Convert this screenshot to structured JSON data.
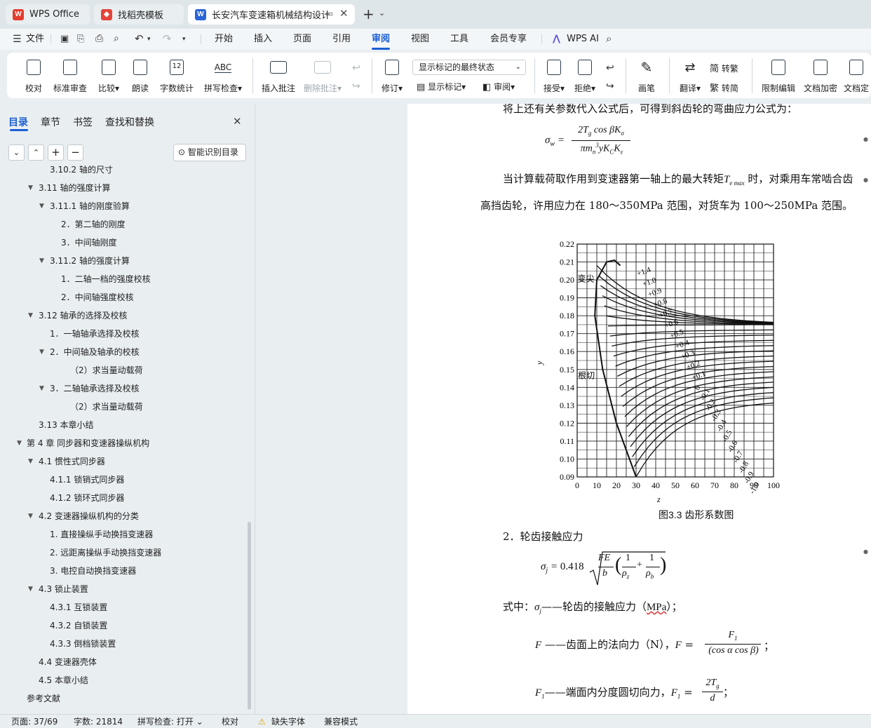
{
  "tabs": {
    "wps_office": "WPS Office",
    "template": "找稻壳模板",
    "document": "长安汽车变速箱机械结构设计"
  },
  "menu": {
    "file": "文件",
    "items": [
      "开始",
      "插入",
      "页面",
      "引用",
      "审阅",
      "视图",
      "工具",
      "会员专享"
    ],
    "active": "审阅",
    "ai": "WPS AI"
  },
  "ribbon": {
    "proofread": "校对",
    "standard_review": "标准审查",
    "compare": "比较",
    "read_aloud": "朗读",
    "word_count": "字数统计",
    "spell_check": "拼写检查",
    "insert_comment": "插入批注",
    "delete_comment": "删除批注",
    "track_changes": "修订",
    "markup_state": "显示标记的最终状态",
    "show_markup": "显示标记",
    "review": "审阅",
    "accept": "接受",
    "reject": "拒绝",
    "pen": "画笔",
    "translate": "翻译",
    "to_traditional": "转繁",
    "to_simplified": "转简",
    "restrict_editing": "限制编辑",
    "doc_encrypt": "文档加密",
    "doc_final": "文档定",
    "word_count_icon": "12",
    "spell_icon": "ABC"
  },
  "nav": {
    "tabs": [
      "目录",
      "章节",
      "书签",
      "查找和替换"
    ],
    "smart_toc": "智能识别目录",
    "items": [
      {
        "text": "3.10.2 轴的尺寸",
        "level": 3,
        "tri": ""
      },
      {
        "text": "3.11 轴的强度计算",
        "level": 2,
        "tri": "▼"
      },
      {
        "text": "3.11.1 轴的刚度验算",
        "level": 3,
        "tri": "▼"
      },
      {
        "text": "2．第二轴的刚度",
        "level": 4,
        "tri": ""
      },
      {
        "text": "3．中间轴刚度",
        "level": 4,
        "tri": ""
      },
      {
        "text": "3.11.2 轴的强度计算",
        "level": 3,
        "tri": "▼"
      },
      {
        "text": "1．二轴一档的强度校核",
        "level": 4,
        "tri": ""
      },
      {
        "text": "2．中间轴强度校核",
        "level": 4,
        "tri": ""
      },
      {
        "text": "3.12 轴承的选择及校核",
        "level": 2,
        "tri": "▼"
      },
      {
        "text": "1．一轴轴承选择及校核",
        "level": 3,
        "tri": ""
      },
      {
        "text": "2．中间轴及轴承的校核",
        "level": 3,
        "tri": "▼"
      },
      {
        "text": "（2）求当量动载荷",
        "level": 5,
        "tri": ""
      },
      {
        "text": "3．二轴轴承选择及校核",
        "level": 3,
        "tri": "▼"
      },
      {
        "text": "（2）求当量动载荷",
        "level": 5,
        "tri": ""
      },
      {
        "text": "3.13 本章小结",
        "level": 2,
        "tri": ""
      },
      {
        "text": "第 4 章  同步器和变速器操纵机构",
        "level": 1,
        "tri": "▼"
      },
      {
        "text": "4.1 惯性式同步器",
        "level": 2,
        "tri": "▼"
      },
      {
        "text": "4.1.1 锁销式同步器",
        "level": 3,
        "tri": ""
      },
      {
        "text": "4.1.2 锁环式同步器",
        "level": 3,
        "tri": ""
      },
      {
        "text": "4.2  变速器操纵机构的分类",
        "level": 2,
        "tri": "▼"
      },
      {
        "text": "1. 直接操纵手动换挡变速器",
        "level": 3,
        "tri": ""
      },
      {
        "text": "2. 远距离操纵手动换挡变速器",
        "level": 3,
        "tri": ""
      },
      {
        "text": "3. 电控自动换挡变速器",
        "level": 3,
        "tri": ""
      },
      {
        "text": "4.3 锁止装置",
        "level": 2,
        "tri": "▼"
      },
      {
        "text": "4.3.1 互锁装置",
        "level": 3,
        "tri": ""
      },
      {
        "text": "4.3.2 自锁装置",
        "level": 3,
        "tri": ""
      },
      {
        "text": "4.3.3 倒档锁装置",
        "level": 3,
        "tri": ""
      },
      {
        "text": "4.4 变速器壳体",
        "level": 2,
        "tri": ""
      },
      {
        "text": "4.5 本章小结",
        "level": 2,
        "tri": ""
      },
      {
        "text": "参考文献",
        "level": 1,
        "tri": ""
      }
    ]
  },
  "doc": {
    "line0": "将上还有关参数代入公式后，可得到斜齿轮的弯曲应力公式为：",
    "para1a": "当计算载荷取作用到变速器第一轴上的最大转矩",
    "para1b": "时，对乘用车常啮合齿",
    "para2": "高挡齿轮，许用应力在 180～350MPa 范围，对货车为 100～250MPa 范围。",
    "fig_caption": "图3.3  齿形系数图",
    "section2": "2．轮齿接触应力",
    "where_a": "式中：",
    "where_b": "——轮齿的接触应力（",
    "where_c": "）；",
    "mpa": "MPa",
    "f_line_a": "——齿面上的法向力（N），",
    "f1_line_a": "——端面内分度圆切向力，",
    "formula_coef": "0.418"
  },
  "chart_data": {
    "type": "line",
    "xlabel": "z",
    "ylabel": "y",
    "x_ticks": [
      "0",
      "10",
      "20",
      "30",
      "40",
      "50",
      "60",
      "70",
      "80",
      "90",
      "100"
    ],
    "y_ticks": [
      "0.09",
      "0.10",
      "0.11",
      "0.12",
      "0.13",
      "0.14",
      "0.15",
      "0.16",
      "0.17",
      "0.18",
      "0.19",
      "0.20",
      "0.21",
      "0.22"
    ],
    "xlim": [
      0,
      100
    ],
    "ylim": [
      0.09,
      0.22
    ],
    "grid": true,
    "annotations": [
      "变尖",
      "根切"
    ],
    "curve_labels": [
      "+1.4",
      "+1.0",
      "+0.9",
      "+0.8",
      "+0.7",
      "+0.6",
      "+0.5",
      "+0.4",
      "+0.3",
      "+0.2",
      "+0.1",
      "0",
      "-0.1",
      "-0.2",
      "-0.3",
      "-0.4",
      "-0.5",
      "-0.6",
      "-0.7",
      "-0.8",
      "-0.9",
      "-1.0"
    ],
    "series": [
      {
        "name": "+1.4",
        "x": [
          10,
          20,
          40,
          60,
          80,
          100
        ],
        "y": [
          0.205,
          0.2,
          0.189,
          0.182,
          0.178,
          0.175
        ]
      },
      {
        "name": "+0.7",
        "x": [
          10,
          20,
          40,
          60,
          80,
          100
        ],
        "y": [
          0.19,
          0.188,
          0.184,
          0.18,
          0.177,
          0.175
        ]
      },
      {
        "name": "+0.5",
        "x": [
          15,
          20,
          40,
          60,
          80,
          100
        ],
        "y": [
          0.172,
          0.175,
          0.177,
          0.177,
          0.176,
          0.175
        ]
      },
      {
        "name": "0",
        "x": [
          23,
          30,
          40,
          60,
          80,
          100
        ],
        "y": [
          0.135,
          0.144,
          0.152,
          0.161,
          0.166,
          0.169
        ]
      },
      {
        "name": "-0.5",
        "x": [
          28,
          40,
          60,
          80,
          100
        ],
        "y": [
          0.1,
          0.12,
          0.136,
          0.145,
          0.151
        ]
      },
      {
        "name": "-1.0",
        "x": [
          30,
          40,
          60,
          80,
          100
        ],
        "y": [
          0.09,
          0.1,
          0.115,
          0.124,
          0.13
        ]
      }
    ]
  },
  "status": {
    "page": "页面: 37/69",
    "words": "字数: 21814",
    "spell": "拼写检查: 打开",
    "proof": "校对",
    "missing_font": "缺失字体",
    "compat": "兼容模式"
  },
  "colors": {
    "active_menu": "#1a5fd6",
    "wps_red": "#e43c2f",
    "doc_blue": "#2b64d8"
  }
}
